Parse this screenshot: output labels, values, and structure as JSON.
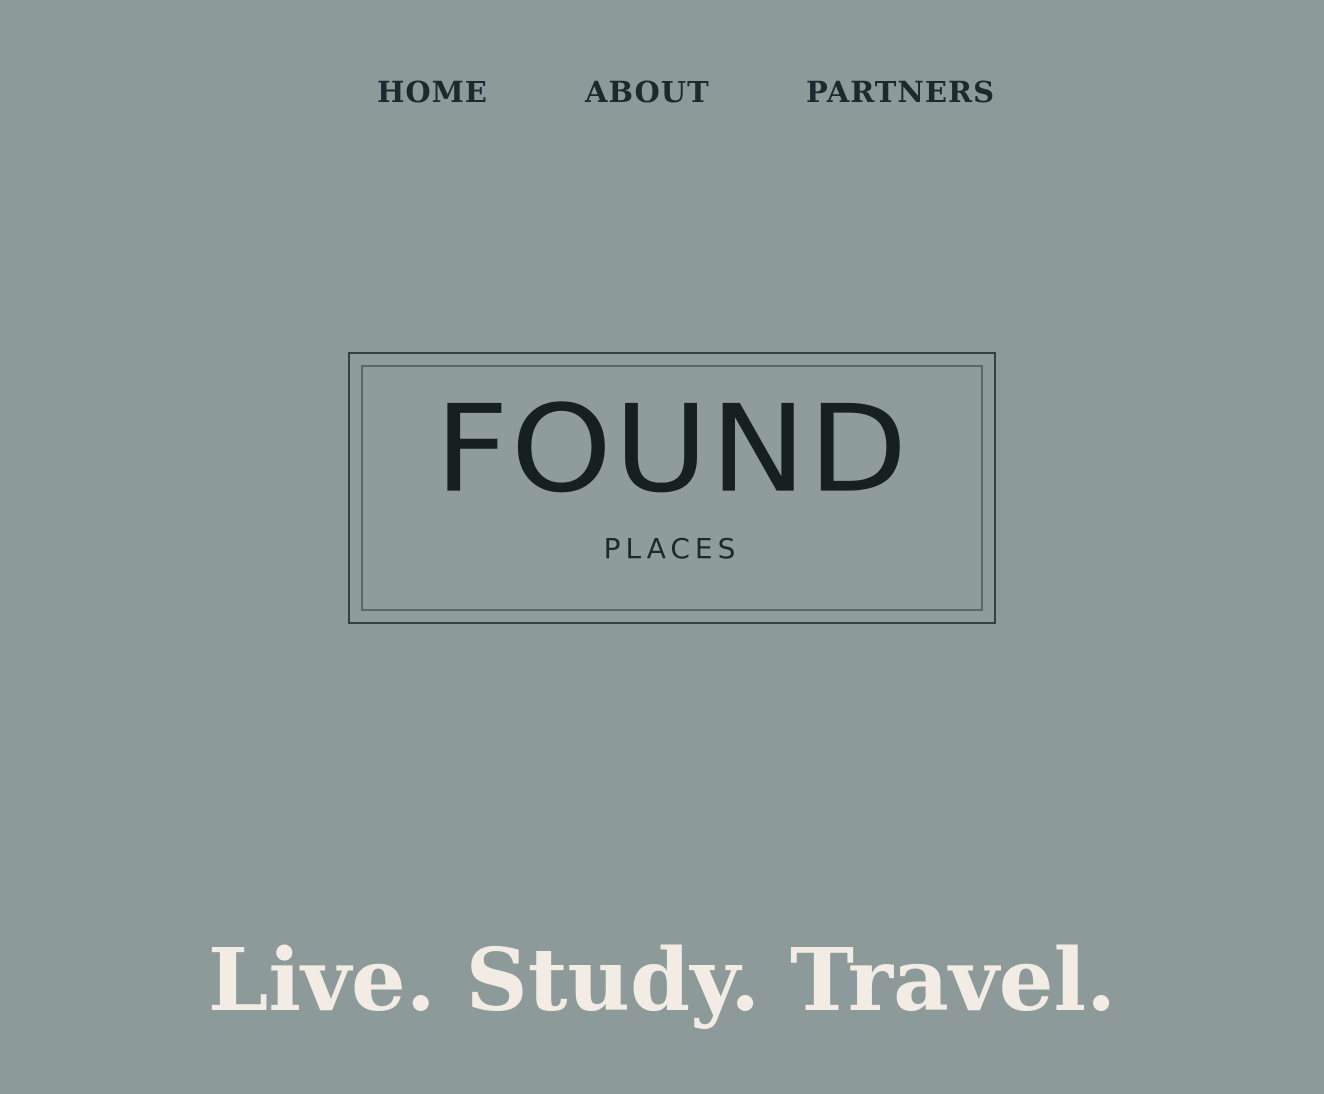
{
  "nav": {
    "items": [
      {
        "label": "HOME"
      },
      {
        "label": "ABOUT"
      },
      {
        "label": "PARTNERS"
      }
    ]
  },
  "logo": {
    "word": "FOUND",
    "subword": "PLACES"
  },
  "hero": {
    "tagline": "Live. Study. Travel."
  },
  "colors": {
    "background": "#8c9b9a",
    "nav_text": "#1c2a30",
    "logo_text": "#15211f",
    "tagline_text": "#f3ece4"
  }
}
